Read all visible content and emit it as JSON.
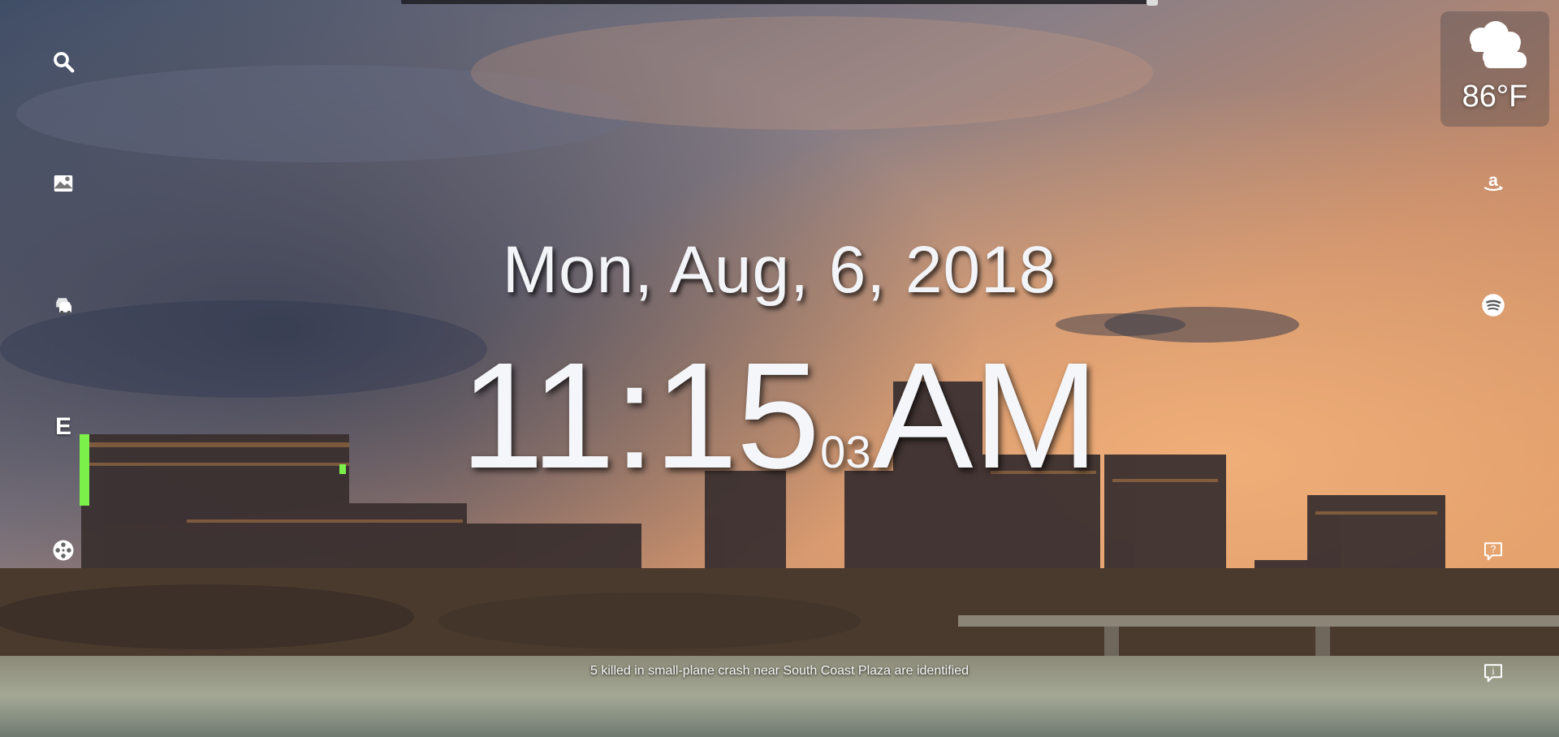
{
  "date": "Mon, Aug, 6, 2018",
  "clock": {
    "hours_minutes": "11:15",
    "seconds": "03",
    "ampm": "AM"
  },
  "weather": {
    "temperature": "86°F",
    "icon": "cloud-icon"
  },
  "news": {
    "headline": "5 killed in small-plane crash near South Coast Plaza are identified"
  },
  "left_sidebar": {
    "icons": [
      "search-icon",
      "map-icon",
      "traffic-icon",
      "e-letter-icon",
      "film-reel-icon"
    ],
    "e_label": "E"
  },
  "right_sidebar": {
    "icons": [
      "amazon-icon",
      "spotify-icon",
      "help-icon",
      "info-icon"
    ]
  },
  "colors": {
    "text": "#ffffff",
    "sky_top": "#5a6a86",
    "sunset": "#e8955a",
    "water": "#9aa08c"
  }
}
